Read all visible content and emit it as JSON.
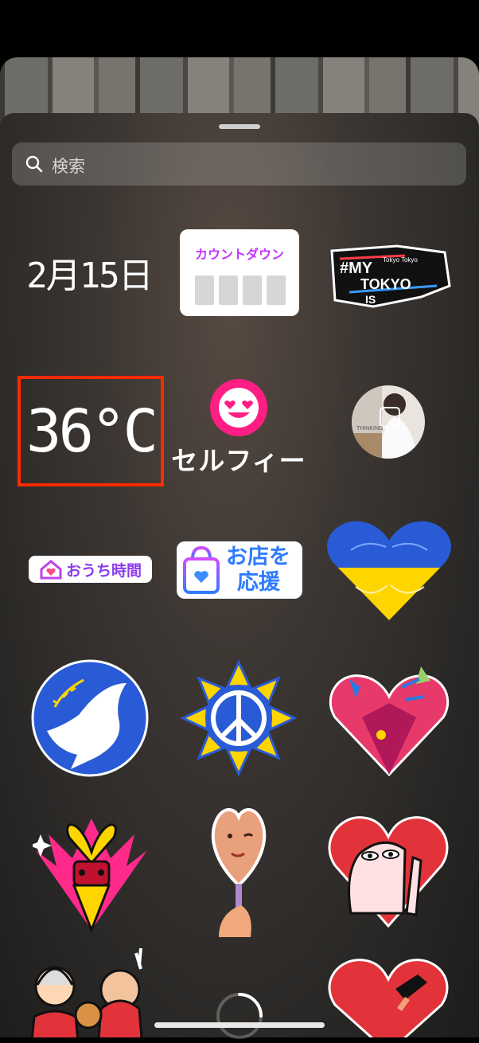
{
  "search": {
    "placeholder": "検索",
    "icon": "search-icon"
  },
  "stickers": {
    "date": "2月15日",
    "countdown_label": "カウントダウン",
    "tokyo_badge": {
      "line1": "#MY",
      "line2": "TOKYO",
      "line3": "IS",
      "tag": "Tokyo Tokyo"
    },
    "temperature": "36°C",
    "selfie_label": "セルフィー",
    "thumbnail_text": "THINKING",
    "stay_home": "おうち時間",
    "support_store_line1": "お店を",
    "support_store_line2": "応援"
  },
  "colors": {
    "highlight": "#ff2a00",
    "countdown_accent": "#c234ff",
    "selfie_pink": "#ff1e83",
    "ukraine_blue": "#2a5bd7",
    "ukraine_yellow": "#ffd500"
  }
}
